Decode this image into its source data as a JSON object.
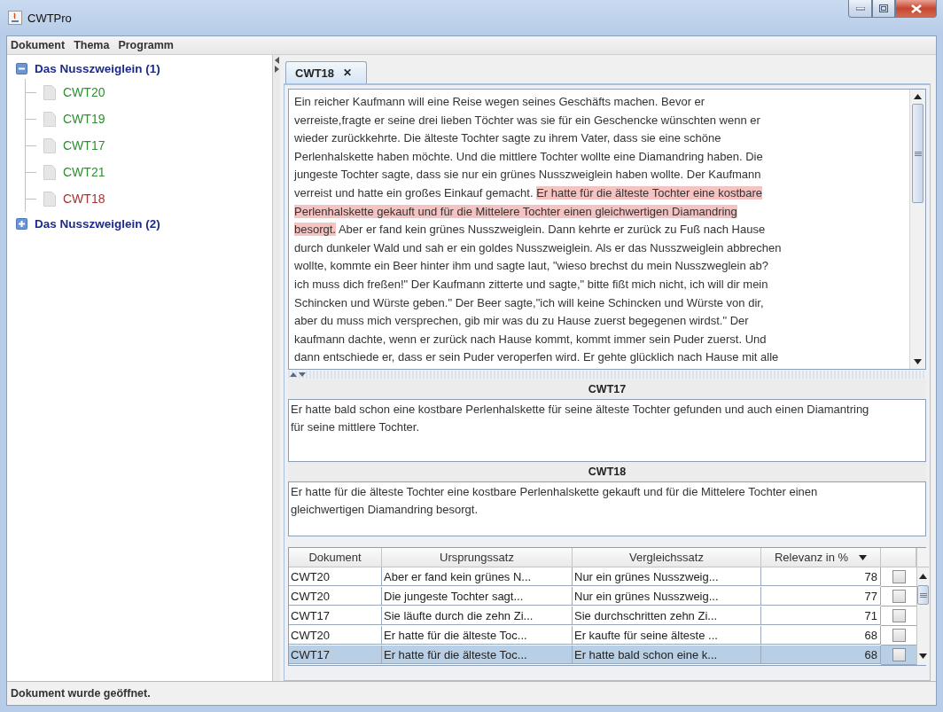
{
  "window": {
    "title": "CWTPro"
  },
  "menu": [
    "Dokument",
    "Thema",
    "Programm"
  ],
  "tree": [
    {
      "label": "Das Nusszweiglein (1)",
      "expanded": true,
      "children": [
        {
          "label": "CWT20",
          "color": "#2e8f2e"
        },
        {
          "label": "CWT19",
          "color": "#2e8f2e"
        },
        {
          "label": "CWT17",
          "color": "#2e8f2e"
        },
        {
          "label": "CWT21",
          "color": "#2e8f2e"
        },
        {
          "label": "CWT18",
          "color": "#a83232"
        }
      ]
    },
    {
      "label": "Das Nusszweiglein (2)",
      "expanded": false
    }
  ],
  "tabs": [
    {
      "label": "CWT18",
      "close": "✕",
      "selected": true
    }
  ],
  "document": {
    "lines": [
      [
        {
          "text": "Ein reicher Kaufmann will eine Reise wegen seines Geschäfts machen. Bevor er",
          "highlighted": false
        }
      ],
      [
        {
          "text": "verreiste,fragte er seine drei lieben Töchter was sie für ein Geschencke wünschten wenn er",
          "highlighted": false
        }
      ],
      [
        {
          "text": "wieder zurückkehrte. Die älteste Tochter sagte zu ihrem Vater, dass sie eine schöne",
          "highlighted": false
        }
      ],
      [
        {
          "text": "Perlenhalskette haben möchte. Und die mittlere Tochter wollte eine Diamandring haben. Die",
          "highlighted": false
        }
      ],
      [
        {
          "text": "jungeste Tochter sagte, dass sie nur ein grünes Nusszweiglein haben wollte. Der Kaufmann",
          "highlighted": false
        }
      ],
      [
        {
          "text": "verreist und hatte ein großes Einkauf gemacht. ",
          "highlighted": false
        },
        {
          "text": "Er hatte für die älteste Tochter eine kostbare",
          "highlighted": true
        }
      ],
      [
        {
          "text": "Perlenhalskette gekauft und für die Mittelere Tochter einen gleichwertigen Diamandring",
          "highlighted": true
        }
      ],
      [
        {
          "text": "besorgt.",
          "highlighted": true
        },
        {
          "text": " Aber er fand kein grünes Nusszweiglein. Dann kehrte er zurück zu Fuß nach Hause",
          "highlighted": false
        }
      ],
      [
        {
          "text": "durch dunkeler Wald und sah er ein goldes Nusszweiglein. Als er das Nusszweiglein abbrechen",
          "highlighted": false
        }
      ],
      [
        {
          "text": "wollte, kommte ein Beer hinter ihm und sagte laut, \"wieso brechst du mein Nusszweglein ab?",
          "highlighted": false
        }
      ],
      [
        {
          "text": "ich muss dich freßen!\" Der Kaufmann zitterte und sagte,\" bitte fißt mich nicht, ich will dir mein",
          "highlighted": false
        }
      ],
      [
        {
          "text": "Schincken und Würste geben.\" Der Beer sagte,\"ich will keine Schincken und Würste von dir,",
          "highlighted": false
        }
      ],
      [
        {
          "text": "aber du muss mich versprechen, gib mir was du zu Hause zuerst begegenen wirdst.\" Der",
          "highlighted": false
        }
      ],
      [
        {
          "text": "kaufmann dachte, wenn er zurück nach Hause kommt, kommt immer sein Puder zuerst. Und",
          "highlighted": false
        }
      ],
      [
        {
          "text": "dann entschiede er, dass er sein Puder veroperfen wird. Er gehte glücklich nach Hause mit alle",
          "highlighted": false
        }
      ]
    ]
  },
  "comparisons": [
    {
      "title": "CWT17",
      "text": "Er hatte bald schon eine kostbare Perlenhalskette für seine älteste Tochter gefunden und auch einen Diamantring für seine mittlere Tochter."
    },
    {
      "title": "CWT18",
      "text": "Er hatte für die älteste Tochter eine kostbare Perlenhalskette gekauft und für die Mittelere Tochter einen gleichwertigen Diamandring besorgt."
    }
  ],
  "table": {
    "columns": [
      {
        "label": "Dokument",
        "sorted": false
      },
      {
        "label": "Ursprungssatz",
        "sorted": false
      },
      {
        "label": "Vergleichssatz",
        "sorted": false
      },
      {
        "label": "Relevanz in %",
        "sorted": true
      }
    ],
    "rows": [
      {
        "cells": [
          "CWT20",
          "Aber er fand kein grünes N...",
          "Nur ein grünes Nusszweig...",
          "78"
        ],
        "checked": false,
        "selected": false
      },
      {
        "cells": [
          "CWT20",
          "Die jungeste Tochter sagt...",
          "Nur ein grünes Nusszweig...",
          "77"
        ],
        "checked": false,
        "selected": false
      },
      {
        "cells": [
          "CWT17",
          "Sie läufte durch die zehn Zi...",
          "Sie durchschritten zehn Zi...",
          "71"
        ],
        "checked": false,
        "selected": false
      },
      {
        "cells": [
          "CWT20",
          "Er hatte für die älteste Toc...",
          "Er kaufte für seine älteste ...",
          "68"
        ],
        "checked": false,
        "selected": false
      },
      {
        "cells": [
          "CWT17",
          "Er hatte für die älteste Toc...",
          "Er hatte bald schon eine k...",
          "68"
        ],
        "checked": false,
        "selected": true
      }
    ]
  },
  "status_bar": "Dokument wurde geöffnet."
}
